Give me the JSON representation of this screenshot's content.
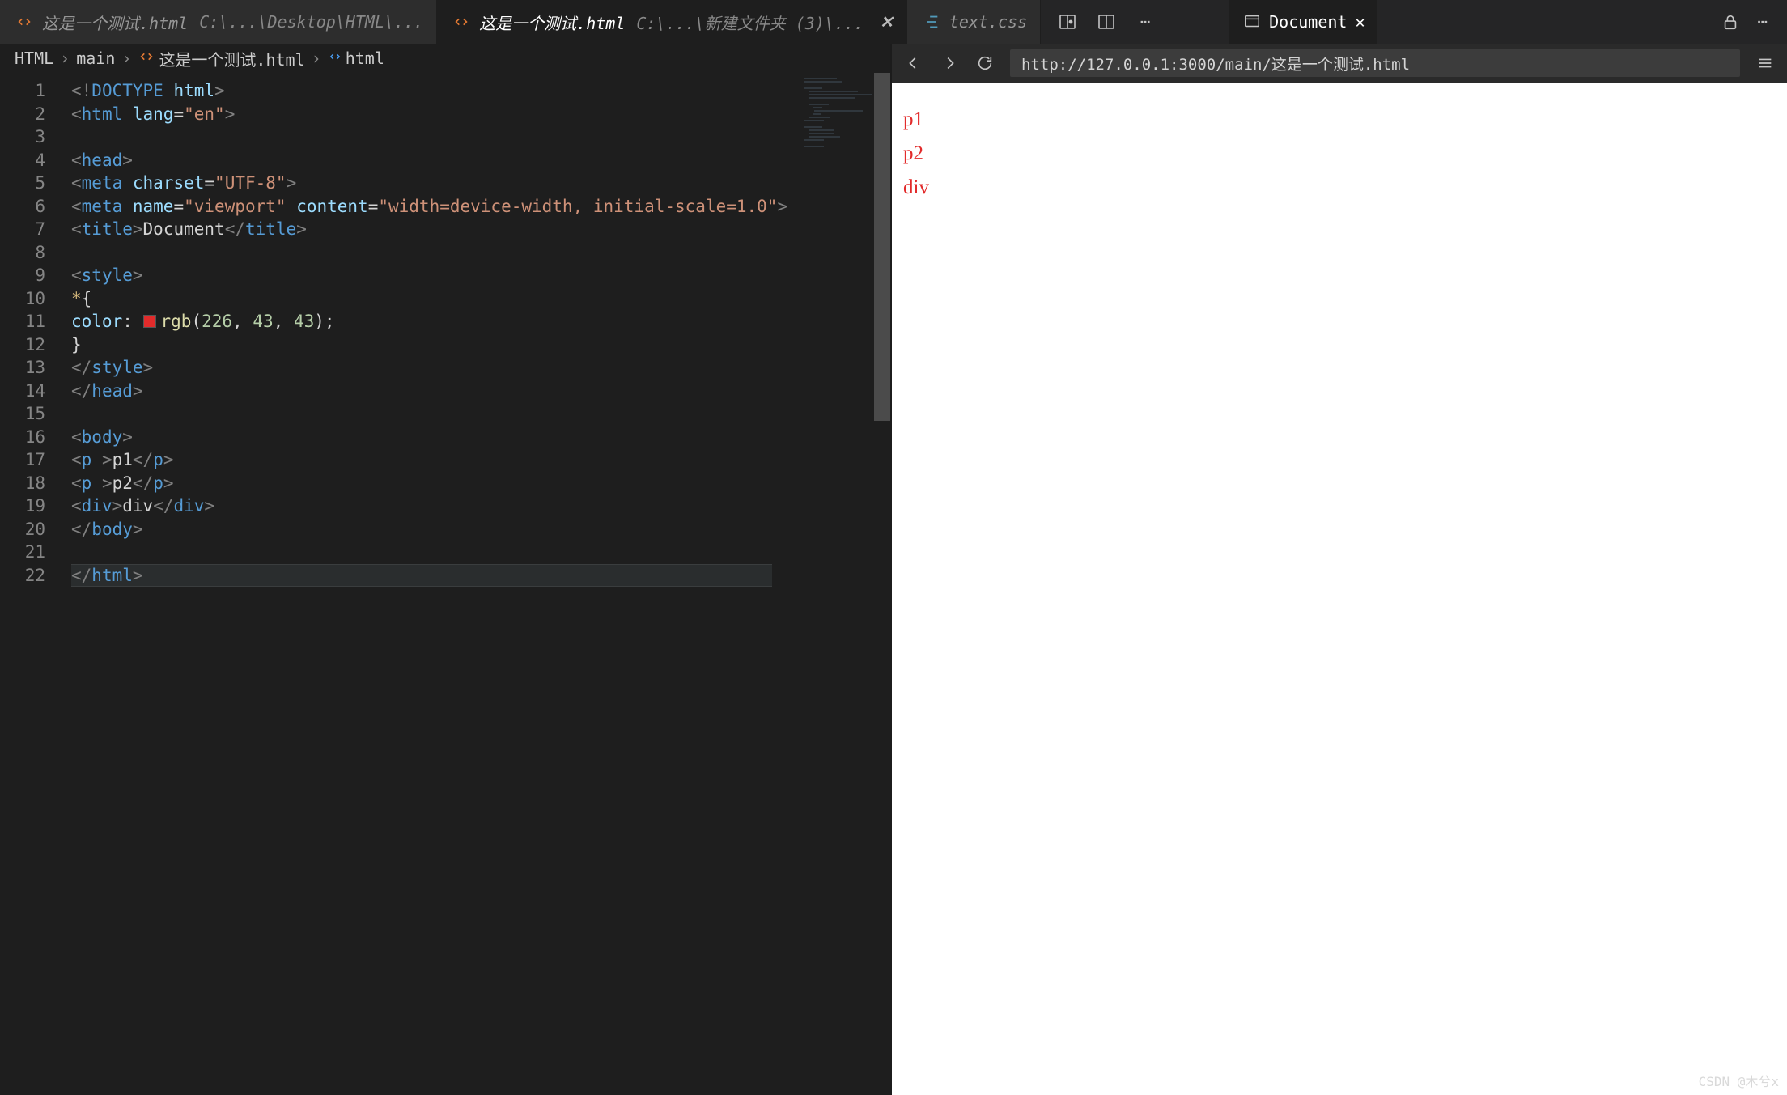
{
  "tabs": [
    {
      "label": "这是一个测试.html",
      "path": "C:\\...\\Desktop\\HTML\\...",
      "icon": "html",
      "active": false,
      "close": false
    },
    {
      "label": "这是一个测试.html",
      "path": "C:\\...\\新建文件夹 (3)\\...",
      "icon": "html",
      "active": true,
      "close": true
    },
    {
      "label": "text.css",
      "path": "",
      "icon": "css",
      "active": false,
      "close": false
    }
  ],
  "titlebar_right": {
    "lock": "🔒",
    "more": "⋯"
  },
  "breadcrumb": [
    {
      "text": "HTML",
      "icon": ""
    },
    {
      "text": "main",
      "icon": ""
    },
    {
      "text": "这是一个测试.html",
      "icon": "html"
    },
    {
      "text": "html",
      "icon": "tag"
    }
  ],
  "code_lines": [
    {
      "n": 1,
      "seg": [
        [
          "t-gray",
          "<!"
        ],
        [
          "t-blue",
          "DOCTYPE "
        ],
        [
          "t-lblue",
          "html"
        ],
        [
          "t-gray",
          ">"
        ]
      ]
    },
    {
      "n": 2,
      "seg": [
        [
          "t-gray",
          "<"
        ],
        [
          "t-blue",
          "html"
        ],
        [
          "t-lblue",
          " lang"
        ],
        [
          "t-white",
          "="
        ],
        [
          "t-str",
          "\"en\""
        ],
        [
          "t-gray",
          ">"
        ]
      ]
    },
    {
      "n": 3,
      "seg": []
    },
    {
      "n": 4,
      "seg": [
        [
          "t-gray",
          "<"
        ],
        [
          "t-blue",
          "head"
        ],
        [
          "t-gray",
          ">"
        ]
      ]
    },
    {
      "n": 5,
      "ind": 1,
      "seg": [
        [
          "t-gray",
          "<"
        ],
        [
          "t-blue",
          "meta"
        ],
        [
          "t-lblue",
          " charset"
        ],
        [
          "t-white",
          "="
        ],
        [
          "t-str",
          "\"UTF-8\""
        ],
        [
          "t-gray",
          ">"
        ]
      ]
    },
    {
      "n": 6,
      "ind": 1,
      "seg": [
        [
          "t-gray",
          "<"
        ],
        [
          "t-blue",
          "meta"
        ],
        [
          "t-lblue",
          " name"
        ],
        [
          "t-white",
          "="
        ],
        [
          "t-str",
          "\"viewport\""
        ],
        [
          "t-lblue",
          " content"
        ],
        [
          "t-white",
          "="
        ],
        [
          "t-str",
          "\"width=device-width, initial-scale=1.0\""
        ],
        [
          "t-gray",
          ">"
        ]
      ]
    },
    {
      "n": 7,
      "ind": 1,
      "seg": [
        [
          "t-gray",
          "<"
        ],
        [
          "t-blue",
          "title"
        ],
        [
          "t-gray",
          ">"
        ],
        [
          "t-white",
          "Document"
        ],
        [
          "t-gray",
          "</"
        ],
        [
          "t-blue",
          "title"
        ],
        [
          "t-gray",
          ">"
        ]
      ]
    },
    {
      "n": 8,
      "seg": []
    },
    {
      "n": 9,
      "ind": 1,
      "seg": [
        [
          "t-gray",
          "<"
        ],
        [
          "t-blue",
          "style"
        ],
        [
          "t-gray",
          ">"
        ]
      ]
    },
    {
      "n": 10,
      "ind": 2,
      "seg": [
        [
          "t-yellow",
          "*"
        ],
        [
          "t-white",
          "{"
        ]
      ]
    },
    {
      "n": 11,
      "ind": 2,
      "seg": [
        [
          "t-lblue",
          "color"
        ],
        [
          "t-white",
          ": "
        ],
        [
          "colorbox",
          ""
        ],
        [
          "t-func",
          "rgb"
        ],
        [
          "t-white",
          "("
        ],
        [
          "t-green",
          "226"
        ],
        [
          "t-white",
          ", "
        ],
        [
          "t-green",
          "43"
        ],
        [
          "t-white",
          ", "
        ],
        [
          "t-green",
          "43"
        ],
        [
          "t-white",
          ");"
        ]
      ]
    },
    {
      "n": 12,
      "ind": 2,
      "seg": [
        [
          "t-white",
          "}"
        ]
      ]
    },
    {
      "n": 13,
      "ind": 1,
      "seg": [
        [
          "t-gray",
          "</"
        ],
        [
          "t-blue",
          "style"
        ],
        [
          "t-gray",
          ">"
        ]
      ]
    },
    {
      "n": 14,
      "seg": [
        [
          "t-gray",
          "</"
        ],
        [
          "t-blue",
          "head"
        ],
        [
          "t-gray",
          ">"
        ]
      ]
    },
    {
      "n": 15,
      "seg": []
    },
    {
      "n": 16,
      "seg": [
        [
          "t-gray",
          "<"
        ],
        [
          "t-blue",
          "body"
        ],
        [
          "t-gray",
          ">"
        ]
      ]
    },
    {
      "n": 17,
      "ind": 1,
      "seg": [
        [
          "t-gray",
          "<"
        ],
        [
          "t-blue",
          "p "
        ],
        [
          "t-gray",
          ">"
        ],
        [
          "t-white",
          "p1"
        ],
        [
          "t-gray",
          "</"
        ],
        [
          "t-blue",
          "p"
        ],
        [
          "t-gray",
          ">"
        ]
      ]
    },
    {
      "n": 18,
      "ind": 1,
      "seg": [
        [
          "t-gray",
          "<"
        ],
        [
          "t-blue",
          "p "
        ],
        [
          "t-gray",
          ">"
        ],
        [
          "t-white",
          "p2"
        ],
        [
          "t-gray",
          "</"
        ],
        [
          "t-blue",
          "p"
        ],
        [
          "t-gray",
          ">"
        ]
      ]
    },
    {
      "n": 19,
      "ind": 1,
      "seg": [
        [
          "t-gray",
          "<"
        ],
        [
          "t-blue",
          "div"
        ],
        [
          "t-gray",
          ">"
        ],
        [
          "t-white",
          "div"
        ],
        [
          "t-gray",
          "</"
        ],
        [
          "t-blue",
          "div"
        ],
        [
          "t-gray",
          ">"
        ]
      ]
    },
    {
      "n": 20,
      "seg": [
        [
          "t-gray",
          "</"
        ],
        [
          "t-blue",
          "body"
        ],
        [
          "t-gray",
          ">"
        ]
      ]
    },
    {
      "n": 21,
      "seg": []
    },
    {
      "n": 22,
      "hl": true,
      "seg": [
        [
          "t-gray",
          "</"
        ],
        [
          "t-blue",
          "html"
        ],
        [
          "t-gray",
          ">"
        ]
      ]
    }
  ],
  "preview": {
    "tab_label": "Document",
    "url": "http://127.0.0.1:3000/main/这是一个测试.html",
    "nodes": [
      {
        "tag": "P",
        "text": "p1"
      },
      {
        "tag": "P",
        "text": "p2"
      },
      {
        "tag": "DIV",
        "text": "div"
      }
    ]
  },
  "watermark": "CSDN @木兮x"
}
